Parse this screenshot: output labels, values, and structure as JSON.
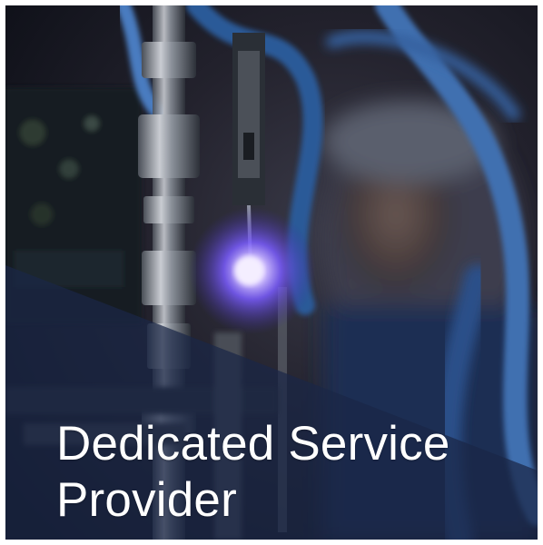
{
  "tile": {
    "image_subject": "technician-with-service-equipment-photo",
    "headline": {
      "line1": "Dedicated Service",
      "line2": "Provider"
    }
  },
  "colors": {
    "overlay": "#1a2747",
    "glow": "#7a5cff",
    "hose": "#3f6fb0",
    "text": "#ffffff"
  }
}
